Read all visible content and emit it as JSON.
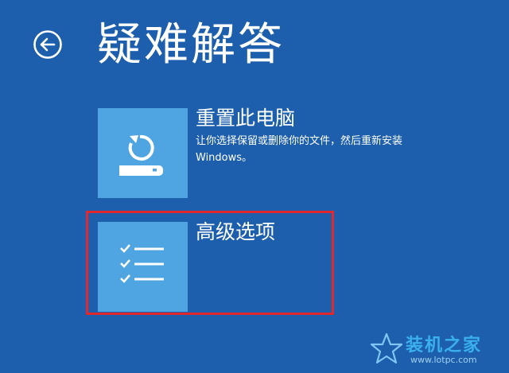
{
  "page": {
    "title": "疑难解答"
  },
  "options": {
    "reset": {
      "title": "重置此电脑",
      "description": "让你选择保留或删除你的文件，然后重新安装 Windows。"
    },
    "advanced": {
      "title": "高级选项"
    }
  },
  "watermark": {
    "text": "装机之家",
    "url": "www.lotpc.com"
  },
  "icons": {
    "back": "back-arrow-icon",
    "reset": "reset-pc-icon",
    "advanced": "checklist-icon",
    "watermark": "star-icon"
  },
  "colors": {
    "background": "#1d5fac",
    "tile": "#4ea5e2",
    "highlight": "#e0282e"
  }
}
